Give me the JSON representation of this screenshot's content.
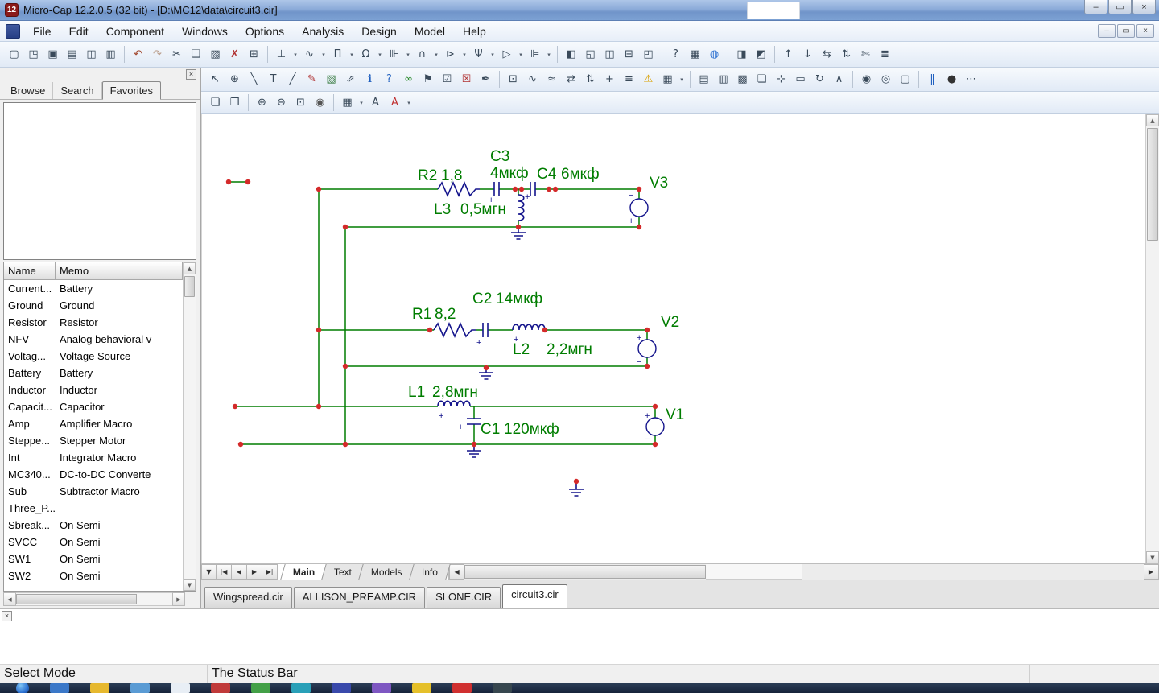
{
  "window": {
    "title": "Micro-Cap 12.2.0.5 (32 bit) - [D:\\MC12\\data\\circuit3.cir]",
    "app_badge": "12",
    "controls": {
      "minimize": "–",
      "restore": "▭",
      "close": "×"
    }
  },
  "menu": {
    "items": [
      "File",
      "Edit",
      "Component",
      "Windows",
      "Options",
      "Analysis",
      "Design",
      "Model",
      "Help"
    ],
    "mdi": {
      "minimize": "–",
      "restore": "▭",
      "close": "×"
    }
  },
  "toolbars": {
    "drop_glyph": "▾",
    "main": [
      {
        "name": "new-file-button",
        "glyph": "▢"
      },
      {
        "name": "open-file-button",
        "glyph": "◳"
      },
      {
        "name": "save-file-button",
        "glyph": "▣"
      },
      {
        "name": "save-all-button",
        "glyph": "▤"
      },
      {
        "name": "print-preview-button",
        "glyph": "◫"
      },
      {
        "name": "print-button",
        "glyph": "▥"
      },
      {
        "sep": true
      },
      {
        "name": "undo-button",
        "glyph": "↶",
        "color": "#a2492f"
      },
      {
        "name": "redo-button",
        "glyph": "↷",
        "color": "#b99c8a"
      },
      {
        "name": "cut-button",
        "glyph": "✂"
      },
      {
        "name": "copy-button",
        "glyph": "❏"
      },
      {
        "name": "paste-button",
        "glyph": "▨"
      },
      {
        "name": "delete-button",
        "glyph": "✗",
        "color": "#b03030"
      },
      {
        "name": "select-all-button",
        "glyph": "⊞"
      },
      {
        "sep": true
      },
      {
        "name": "ground-component-button",
        "glyph": "⊥",
        "dropdown": true
      },
      {
        "name": "sine-source-component-button",
        "glyph": "∿",
        "dropdown": true
      },
      {
        "name": "pulse-source-component-button",
        "glyph": "П",
        "dropdown": true
      },
      {
        "name": "resistor-component-button",
        "glyph": "Ω",
        "dropdown": true
      },
      {
        "name": "capacitor-component-button",
        "glyph": "⊪",
        "dropdown": true
      },
      {
        "name": "inductor-component-button",
        "glyph": "∩",
        "dropdown": true
      },
      {
        "name": "diode-component-button",
        "glyph": "⊳",
        "dropdown": true
      },
      {
        "name": "transistor-component-button",
        "glyph": "Ψ",
        "dropdown": true
      },
      {
        "name": "opamp-component-button",
        "glyph": "▷",
        "dropdown": true
      },
      {
        "name": "battery-component-button",
        "glyph": "⊫",
        "dropdown": true
      },
      {
        "sep": true
      },
      {
        "name": "new-window-button",
        "glyph": "◧"
      },
      {
        "name": "cascade-windows-button",
        "glyph": "◱"
      },
      {
        "name": "tile-vertical-button",
        "glyph": "◫"
      },
      {
        "name": "tile-horizontal-button",
        "glyph": "⊟"
      },
      {
        "name": "split-window-button",
        "glyph": "◰"
      },
      {
        "sep": true
      },
      {
        "name": "help-topics-button",
        "glyph": "?"
      },
      {
        "name": "calculator-button",
        "glyph": "▦"
      },
      {
        "name": "web-button",
        "glyph": "◍",
        "color": "#2a6fd0"
      },
      {
        "sep": true
      },
      {
        "name": "component-editor-button",
        "glyph": "◨"
      },
      {
        "name": "shape-editor-button",
        "glyph": "◩"
      },
      {
        "sep": true
      },
      {
        "name": "to-front-button",
        "glyph": "↑"
      },
      {
        "name": "to-back-button",
        "glyph": "↓"
      },
      {
        "name": "flip-horizontal-button",
        "glyph": "⇆"
      },
      {
        "name": "flip-vertical-button",
        "glyph": "⇅"
      },
      {
        "name": "trim-button",
        "glyph": "✄"
      },
      {
        "name": "preferences-button",
        "glyph": "≣"
      }
    ],
    "edit": [
      {
        "name": "select-mode-button",
        "glyph": "↖"
      },
      {
        "name": "component-mode-button",
        "glyph": "⊕"
      },
      {
        "name": "wire-mode-button",
        "glyph": "╲"
      },
      {
        "name": "text-mode-button",
        "glyph": "T"
      },
      {
        "name": "line-mode-button",
        "glyph": "╱"
      },
      {
        "name": "pencil-mode-button",
        "glyph": "✎",
        "color": "#b03030"
      },
      {
        "name": "picture-mode-button",
        "glyph": "▧",
        "color": "#3a7d44"
      },
      {
        "name": "scale-mode-button",
        "glyph": "⇗"
      },
      {
        "name": "info-mode-button",
        "glyph": "ℹ",
        "color": "#1f5fbf"
      },
      {
        "name": "help-mode-button",
        "glyph": "?",
        "color": "#1f5fbf"
      },
      {
        "name": "link-mode-button",
        "glyph": "∞",
        "color": "#2a8a2a"
      },
      {
        "name": "flag-mode-button",
        "glyph": "⚑"
      },
      {
        "name": "enable-region-button",
        "glyph": "☑"
      },
      {
        "name": "disable-region-button",
        "glyph": "☒",
        "color": "#b03030"
      },
      {
        "name": "edit-page-button",
        "glyph": "✒"
      },
      {
        "sep": true
      },
      {
        "name": "zoom-region-button",
        "glyph": "⊡"
      },
      {
        "name": "probe-button",
        "glyph": "∿"
      },
      {
        "name": "waveform-button",
        "glyph": "≈"
      },
      {
        "name": "horizontal-tag-button",
        "glyph": "⇄"
      },
      {
        "name": "vertical-tag-button",
        "glyph": "⇅"
      },
      {
        "name": "cursor-button",
        "glyph": "+"
      },
      {
        "name": "align-button",
        "glyph": "≡"
      },
      {
        "name": "warning-button",
        "glyph": "⚠",
        "color": "#d9a000"
      },
      {
        "name": "grid-button",
        "glyph": "▦",
        "dropdown": true
      },
      {
        "sep": true
      },
      {
        "name": "text-page-button",
        "glyph": "▤"
      },
      {
        "name": "model-page-button",
        "glyph": "▥"
      },
      {
        "name": "info-page-button",
        "glyph": "▩"
      },
      {
        "name": "clipboard-page-button",
        "glyph": "❏"
      },
      {
        "name": "point-tag-button",
        "glyph": "⊹"
      },
      {
        "name": "box-tool-button",
        "glyph": "▭"
      },
      {
        "name": "rotate-button",
        "glyph": "↻"
      },
      {
        "name": "mirror-button",
        "glyph": "∧"
      },
      {
        "sep": true
      },
      {
        "name": "find-button",
        "glyph": "◉"
      },
      {
        "name": "find-next-button",
        "glyph": "◎"
      },
      {
        "name": "go-to-page-button",
        "glyph": "▢"
      },
      {
        "sep": true
      },
      {
        "name": "pause-button",
        "glyph": "‖",
        "color": "#1f5fbf"
      },
      {
        "name": "stop-button",
        "glyph": "●",
        "color": "#333333"
      },
      {
        "name": "more-button",
        "glyph": "⋯"
      }
    ],
    "view": [
      {
        "name": "copy-front-page-button",
        "glyph": "❏"
      },
      {
        "name": "copy-visible-page-button",
        "glyph": "❐"
      },
      {
        "sep": true
      },
      {
        "name": "zoom-in-button",
        "glyph": "⊕"
      },
      {
        "name": "zoom-out-button",
        "glyph": "⊖"
      },
      {
        "name": "zoom-area-button",
        "glyph": "⊡"
      },
      {
        "name": "snapshot-button",
        "glyph": "◉",
        "color": "#555555"
      },
      {
        "sep": true
      },
      {
        "name": "grid-toggle-button",
        "glyph": "▦",
        "dropdown": true
      },
      {
        "name": "font-button",
        "glyph": "A"
      },
      {
        "name": "color-button",
        "glyph": "A",
        "color": "#c03030",
        "dropdown": true
      }
    ]
  },
  "sidebar": {
    "close_glyph": "×",
    "tabs": [
      {
        "label": "Browse",
        "active": false
      },
      {
        "label": "Search",
        "active": false
      },
      {
        "label": "Favorites",
        "active": true
      }
    ],
    "table": {
      "columns": [
        "Name",
        "Memo"
      ],
      "rows": [
        {
          "name": "Current...",
          "memo": "Battery"
        },
        {
          "name": "Ground",
          "memo": "Ground"
        },
        {
          "name": "Resistor",
          "memo": "Resistor"
        },
        {
          "name": "NFV",
          "memo": "Analog behavioral v"
        },
        {
          "name": "Voltag...",
          "memo": "Voltage Source"
        },
        {
          "name": "Battery",
          "memo": "Battery"
        },
        {
          "name": "Inductor",
          "memo": "Inductor"
        },
        {
          "name": "Capacit...",
          "memo": "Capacitor"
        },
        {
          "name": "Amp",
          "memo": "Amplifier Macro"
        },
        {
          "name": "Steppe...",
          "memo": "Stepper Motor"
        },
        {
          "name": "Int",
          "memo": "Integrator Macro"
        },
        {
          "name": "MC340...",
          "memo": "DC-to-DC Converte"
        },
        {
          "name": "Sub",
          "memo": "Subtractor Macro"
        },
        {
          "name": "Three_P...",
          "memo": ""
        },
        {
          "name": "Sbreak...",
          "memo": "On Semi"
        },
        {
          "name": "SVCC",
          "memo": "On Semi"
        },
        {
          "name": "SW1",
          "memo": "On Semi"
        },
        {
          "name": "SW2",
          "memo": "On Semi"
        }
      ]
    }
  },
  "sheet_tabs": {
    "nav": {
      "menu": "▼",
      "first": "|◀",
      "prev": "◀",
      "next": "▶",
      "last": "▶|"
    },
    "tabs": [
      {
        "label": "Main",
        "active": true
      },
      {
        "label": "Text",
        "active": false
      },
      {
        "label": "Models",
        "active": false
      },
      {
        "label": "Info",
        "active": false
      }
    ]
  },
  "file_tabs": {
    "tabs": [
      {
        "label": "Wingspread.cir",
        "active": false
      },
      {
        "label": "ALLISON_PREAMP.CIR",
        "active": false
      },
      {
        "label": "SLONE.CIR",
        "active": false
      },
      {
        "label": "circuit3.cir",
        "active": true
      }
    ]
  },
  "scrollbar": {
    "up": "▲",
    "down": "▼",
    "left": "◀",
    "right": "▶"
  },
  "message": {
    "close_glyph": "×"
  },
  "status": {
    "mode": "Select Mode",
    "message": "The Status Bar"
  },
  "circuit": {
    "wire_color": "#007d00",
    "component_color": "#14148c",
    "label_color": "#007d00",
    "junction_color": "#d42a2a",
    "labels": {
      "r2": "R2",
      "r2_val": "1,8",
      "c3": "C3",
      "c3_val": "4мкф",
      "c4": "C4",
      "c4_val": "6мкф",
      "v3": "V3",
      "l3": "L3",
      "l3_val": "0,5мгн",
      "c2": "C2",
      "c2_val": "14мкф",
      "r1": "R1",
      "r1_val": "8,2",
      "v2": "V2",
      "l2": "L2",
      "l2_val": "2,2мгн",
      "l1": "L1",
      "l1_val": "2,8мгн",
      "c1": "C1",
      "c1_val": "120мкф",
      "v1": "V1",
      "plus": "+",
      "minus": "−"
    }
  },
  "taskbar": {
    "icons": [
      {
        "name": "taskbar-app-1",
        "color": "#3b78c8"
      },
      {
        "name": "taskbar-app-2",
        "color": "#e6b82e"
      },
      {
        "name": "taskbar-app-3",
        "color": "#5a9bd4"
      },
      {
        "name": "taskbar-app-4",
        "color": "#e8eef5"
      },
      {
        "name": "taskbar-app-5",
        "color": "#c03a3a"
      },
      {
        "name": "taskbar-app-6",
        "color": "#43a047"
      },
      {
        "name": "taskbar-app-7",
        "color": "#29a0b8"
      },
      {
        "name": "taskbar-app-8",
        "color": "#3949ab"
      },
      {
        "name": "taskbar-app-9",
        "color": "#7e57c2"
      },
      {
        "name": "taskbar-app-10",
        "color": "#e5c02a"
      },
      {
        "name": "taskbar-app-11",
        "color": "#d03030"
      },
      {
        "name": "taskbar-app-12",
        "color": "#37474f"
      }
    ]
  }
}
